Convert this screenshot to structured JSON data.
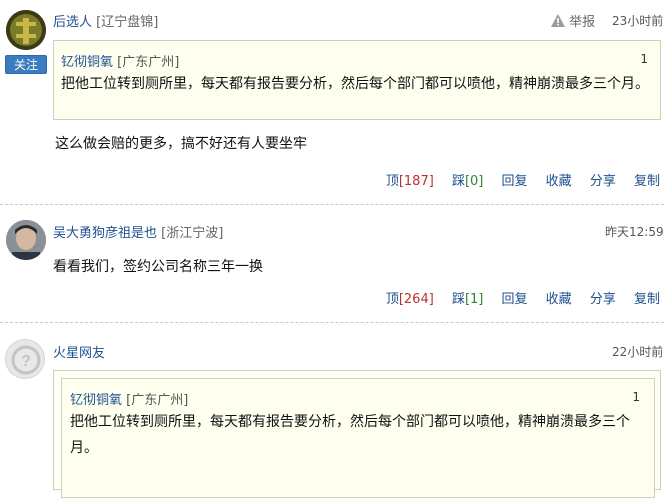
{
  "comments": [
    {
      "username": "后选人",
      "location": "[辽宁盘锦]",
      "report_label": "举报",
      "time": "23小时前",
      "follow_label": "关注",
      "quote": {
        "username": "钇彻铜氧",
        "location": "[广东广州]",
        "floor": "1",
        "text": "把他工位转到厕所里，每天都有报告要分析，然后每个部门都可以喷他，精神崩溃最多三个月。"
      },
      "body": "这么做会赔的更多，搞不好还有人要坐牢",
      "actions": {
        "up_label": "顶",
        "up_count": "[187]",
        "down_label": "踩",
        "down_count": "[0]",
        "reply": "回复",
        "collect": "收藏",
        "share": "分享",
        "copy": "复制"
      }
    },
    {
      "username": "吴大勇狗彦祖是也",
      "location": "[浙江宁波]",
      "time": "昨天12:59",
      "body": "看看我们，签约公司名称三年一换",
      "actions": {
        "up_label": "顶",
        "up_count": "[264]",
        "down_label": "踩",
        "down_count": "[1]",
        "reply": "回复",
        "collect": "收藏",
        "share": "分享",
        "copy": "复制"
      }
    },
    {
      "username": "火星网友",
      "time": "22小时前",
      "quote": {
        "username": "钇彻铜氧",
        "location": "[广东广州]",
        "floor": "1",
        "text": "把他工位转到厕所里，每天都有报告要分析，然后每个部门都可以喷他，精神崩溃最多三个月。"
      }
    }
  ]
}
